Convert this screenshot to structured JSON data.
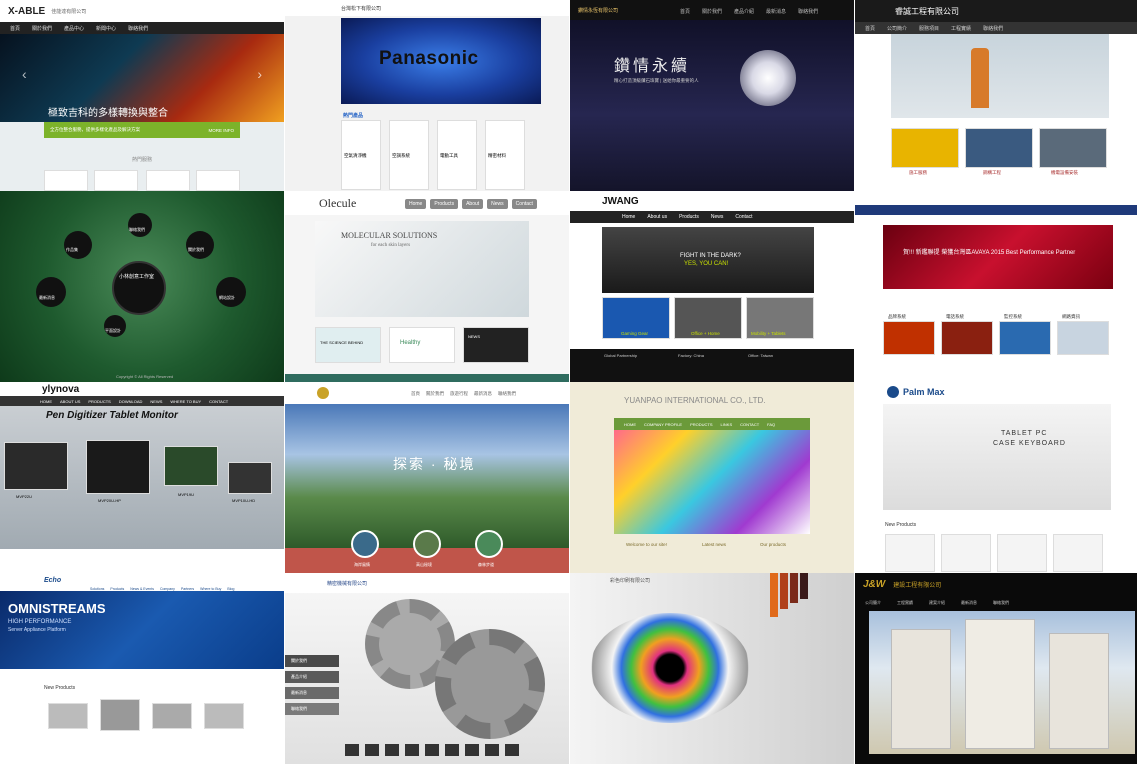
{
  "tiles": {
    "t00": {
      "logo": "X-ABLE",
      "company": "佳能達有限公司",
      "nav": [
        "首頁",
        "關於我們",
        "產品中心",
        "新聞中心",
        "聯絡我們"
      ],
      "banner_text": "極致吉科的多樣轉換與整合",
      "bar_title": "全方位整合服務，提供多樣化產品及解決方案",
      "bar_btn": "MORE INFO",
      "section_label": "熱門服務",
      "colors": {
        "bar": "#7cb32a",
        "banner": "#0b1a2a"
      }
    },
    "t01": {
      "company": "台灣松下有限公司",
      "banner_text": "Panasonic",
      "section_label": "熱門產品",
      "products": [
        {
          "name": "空氣清淨機",
          "btn": "More"
        },
        {
          "name": "空調系統",
          "btn": "More"
        },
        {
          "name": "電動工具",
          "btn": "More"
        },
        {
          "name": "精密材料",
          "btn": "More"
        }
      ],
      "colors": {
        "banner": "#1a3fa0",
        "accent": "#2a67c7"
      }
    },
    "t02": {
      "company": "鑽情永恆有限公司",
      "nav": [
        "首頁",
        "關於我們",
        "產品介紹",
        "最新消息",
        "聯絡我們"
      ],
      "headline": "鑽情永續",
      "tagline": "精心打造頂級鑽石珠寶 | 送給你最重要的人",
      "colors": {
        "bg": "#1e1e3a"
      }
    },
    "t03": {
      "company": "睿誠工程有限公司",
      "nav": [
        "首頁",
        "公司簡介",
        "服務項目",
        "工程實績",
        "聯絡我們"
      ],
      "services": [
        "施工服務",
        "鋼構工程",
        "機電設備安裝"
      ],
      "colors": {
        "header": "#1a1a1a"
      }
    },
    "t10": {
      "center_title": "小林創意工作室",
      "nodes": [
        "作品集",
        "聯絡我們",
        "關於我們",
        "最新消息",
        "網站設計",
        "平面設計"
      ],
      "footer": "Copyright © All Rights Reserved",
      "colors": {
        "bg": "#2c6b3e"
      }
    },
    "t11": {
      "brand": "Olecule",
      "nav": [
        "Home",
        "Products",
        "About",
        "News",
        "Contact"
      ],
      "banner_title": "MOLECULAR SOLUTIONS",
      "banner_sub": "for each skin layers",
      "cards": [
        "THE SCIENCE BEHIND",
        "Healthy",
        "NEWS"
      ],
      "colors": {
        "bar": "#2f6c5f"
      }
    },
    "t12": {
      "logo": "JWANG",
      "nav": [
        "Home",
        "About us",
        "Products",
        "News",
        "Contact"
      ],
      "banner_line1": "FIGHT IN THE DARK?",
      "banner_line2": "YES, YOU CAN!",
      "products": [
        "Gaming Gear",
        "Office + Home",
        "Mobility + Tablets"
      ],
      "footer_cols": [
        "Global Partnership",
        "Factory: China",
        "Office: Taiwan"
      ],
      "colors": {
        "accent": "#c8e000"
      }
    },
    "t13": {
      "banner_text": "賀!!! 新鑑聯提 榮獲台灣區AVAYA 2015 Best Performance Partner",
      "cards": [
        "品牌系統",
        "電話系統",
        "監控系統",
        "網路資訊"
      ],
      "colors": {
        "banner": "#c8102e",
        "nav": "#1f3a7a"
      }
    },
    "t20": {
      "logo": "ylynova",
      "nav": [
        "HOME",
        "ABOUT US",
        "PRODUCTS",
        "DOWNLOAD",
        "NEWS",
        "WHERE TO BUY",
        "CONTACT"
      ],
      "banner_text": "Pen Digitizer Tablet Monitor",
      "models": [
        "MVP22U",
        "MVP20U-HP",
        "MVP19U",
        "MVP10U-HD"
      ],
      "colors": {
        "nav": "#333"
      }
    },
    "t21": {
      "nav": [
        "首頁",
        "關於我們",
        "旅遊行程",
        "最新消息",
        "聯絡我們"
      ],
      "banner_text": "探索 · 秘境",
      "circles": [
        "海岸風情",
        "高山秘境",
        "森林步道"
      ],
      "colors": {
        "band": "#c0554a"
      }
    },
    "t22": {
      "company": "YUANPAO INTERNATIONAL CO., LTD.",
      "nav": [
        "HOME",
        "COMPANY PROFILE",
        "PRODUCTS",
        "LINKS",
        "CONTACT",
        "FAQ"
      ],
      "sections": [
        "Welcome to our site!",
        "Latest news",
        "Our products"
      ],
      "colors": {
        "nav": "#6b9a3a"
      }
    },
    "t23": {
      "brand": "Palm Max",
      "banner_line1": "TABLET PC",
      "banner_line2": "CASE KEYBOARD",
      "section_label": "New Products",
      "colors": {
        "brand": "#1a4a8a"
      }
    },
    "t30": {
      "brand": "Echo",
      "nav": [
        "Solutions",
        "Products",
        "News & Events",
        "Company",
        "Partners",
        "Where to Buy",
        "Blog"
      ],
      "banner_title": "OMNISTREAMS",
      "banner_sub1": "HIGH PERFORMANCE",
      "banner_sub2": "Server Appliance Platform",
      "section_label": "New Products",
      "colors": {
        "banner": "#0a3d8a"
      }
    },
    "t31": {
      "company": "精密機械有限公司",
      "menu": [
        "關於我們",
        "產品介紹",
        "最新消息",
        "聯絡我們"
      ],
      "colors": {
        "menu": "#4a4a4a"
      }
    },
    "t32": {
      "company": "彩色印刷有限公司",
      "colors": {
        "accent": "#e06a1a"
      }
    },
    "t33": {
      "brand": "J&W",
      "company": "建設工程有限公司",
      "nav": [
        "公司簡介",
        "工程實績",
        "建案介紹",
        "最新消息",
        "聯絡我們"
      ],
      "colors": {
        "bg": "#0a0a0a"
      }
    }
  }
}
